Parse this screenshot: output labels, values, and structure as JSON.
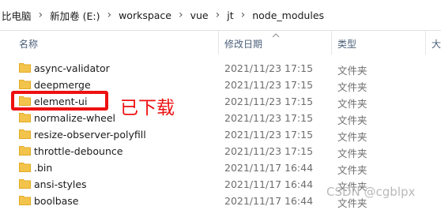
{
  "breadcrumb": [
    "比电脑",
    "新加卷 (E:)",
    "workspace",
    "vue",
    "jt",
    "node_modules"
  ],
  "columns": {
    "name": "名称",
    "modified": "修改日期",
    "type": "类型",
    "size": "大"
  },
  "rows": [
    {
      "name": "async-validator",
      "modified": "2021/11/23 17:15",
      "type": "文件夹"
    },
    {
      "name": "deepmerge",
      "modified": "2021/11/23 17:15",
      "type": "文件夹"
    },
    {
      "name": "element-ui",
      "modified": "2021/11/23 17:15",
      "type": "文件夹"
    },
    {
      "name": "normalize-wheel",
      "modified": "2021/11/23 17:15",
      "type": "文件夹"
    },
    {
      "name": "resize-observer-polyfill",
      "modified": "2021/11/23 17:15",
      "type": "文件夹"
    },
    {
      "name": "throttle-debounce",
      "modified": "2021/11/23 17:15",
      "type": "文件夹"
    },
    {
      "name": ".bin",
      "modified": "2021/11/17 16:44",
      "type": "文件夹"
    },
    {
      "name": "ansi-styles",
      "modified": "2021/11/17 16:44",
      "type": "文件夹"
    },
    {
      "name": "boolbase",
      "modified": "2021/11/17 16:44",
      "type": "文件夹"
    }
  ],
  "annotation": {
    "text": "已下载",
    "color": "#ee1111"
  },
  "watermark": "CSDN @cgblpx",
  "colors": {
    "folder": "#f3c44b",
    "folder_dark": "#e3a923",
    "header_text": "#4c607a"
  }
}
